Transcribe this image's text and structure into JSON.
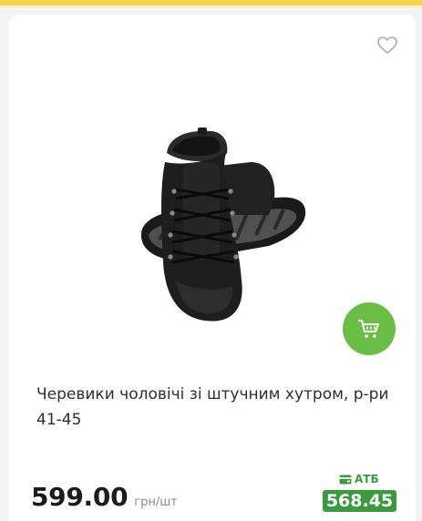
{
  "product": {
    "title": "Черевики чоловічі зі штучним хутром, р-ри 41-45",
    "price": "599.00",
    "unit": "грн/шт",
    "club_label": "АТБ",
    "club_price": "568.45"
  },
  "icons": {
    "favorite": "heart-outline-icon",
    "cart": "cart-icon",
    "card": "wallet-card-icon"
  },
  "colors": {
    "accent_green": "#6bbe45",
    "club_green": "#3a9a3e",
    "top_stripe": "#f6d24a"
  }
}
